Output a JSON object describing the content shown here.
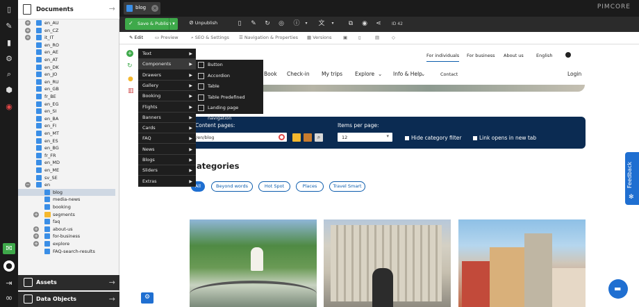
{
  "tree": {
    "header": "Documents",
    "items": [
      {
        "label": "en_AU",
        "indent": 1,
        "exp": true
      },
      {
        "label": "en_CZ",
        "indent": 1,
        "exp": true
      },
      {
        "label": "it_IT",
        "indent": 1,
        "exp": true
      },
      {
        "label": "en_RO",
        "indent": 1
      },
      {
        "label": "en_AE",
        "indent": 1
      },
      {
        "label": "en_AT",
        "indent": 1
      },
      {
        "label": "en_DK",
        "indent": 1
      },
      {
        "label": "en_JO",
        "indent": 1
      },
      {
        "label": "en_RU",
        "indent": 1
      },
      {
        "label": "en_GB",
        "indent": 1
      },
      {
        "label": "fr_BE",
        "indent": 1
      },
      {
        "label": "en_EG",
        "indent": 1
      },
      {
        "label": "en_SI",
        "indent": 1
      },
      {
        "label": "en_BA",
        "indent": 1
      },
      {
        "label": "en_FI",
        "indent": 1
      },
      {
        "label": "en_MT",
        "indent": 1
      },
      {
        "label": "en_ES",
        "indent": 1
      },
      {
        "label": "en_BG",
        "indent": 1
      },
      {
        "label": "fr_FR",
        "indent": 1
      },
      {
        "label": "en_MD",
        "indent": 1
      },
      {
        "label": "en_ME",
        "indent": 1
      },
      {
        "label": "sv_SE",
        "indent": 1
      },
      {
        "label": "en",
        "indent": 1,
        "exp": true,
        "open": true
      },
      {
        "label": "blog",
        "indent": 2,
        "selected": true
      },
      {
        "label": "media-news",
        "indent": 2
      },
      {
        "label": "booking",
        "indent": 2
      },
      {
        "label": "segments",
        "indent": 2,
        "exp": true,
        "folder": true
      },
      {
        "label": "faq",
        "indent": 2
      },
      {
        "label": "about-us",
        "indent": 2,
        "exp": true
      },
      {
        "label": "for-business",
        "indent": 2,
        "exp": true
      },
      {
        "label": "explore",
        "indent": 2,
        "exp": true
      },
      {
        "label": "FAQ-search-results",
        "indent": 2
      }
    ],
    "assets": "Assets",
    "data_objects": "Data Objects"
  },
  "topbar": {
    "tab_label": "blog",
    "brand": "PIMCORE"
  },
  "toolbar": {
    "save_publish": "Save & Publish",
    "unpublish": "Unpublish",
    "id": "ID 42"
  },
  "tabs": [
    "Edit",
    "Preview",
    "SEO & Settings",
    "Navigation & Properties",
    "Versions"
  ],
  "site": {
    "top_nav": [
      "For individuals",
      "For business",
      "About us",
      "English"
    ],
    "main_nav": [
      "Book",
      "Check-in",
      "My trips",
      "Explore",
      "Info & Help",
      "Contact"
    ],
    "login": "Login",
    "content_pages_label": "Content pages:",
    "content_pages_value": "/en/blog",
    "items_per_page_label": "Items per page:",
    "items_per_page_value": "12",
    "hide_category": "Hide category filter",
    "link_new_tab": "Link opens in new tab",
    "categories_title": "ategories",
    "filters": [
      "All",
      "Beyond words",
      "Hot Spot",
      "Places",
      "Travel Smart"
    ]
  },
  "menu": {
    "items": [
      "Text",
      "Components",
      "Drawers",
      "Gallery",
      "Booking",
      "Flights",
      "Banners",
      "Cards",
      "FAQ",
      "News",
      "Blogs",
      "Sliders",
      "Extras"
    ],
    "submenu": [
      "Button",
      "Accordion",
      "Table",
      "Table Predefined",
      "Landing page navigation"
    ]
  },
  "feedback": "Feedback",
  "colors": {
    "save_green": "#3ea94a",
    "nav_blue": "#0b2b52",
    "accent": "#1f6fd1"
  }
}
